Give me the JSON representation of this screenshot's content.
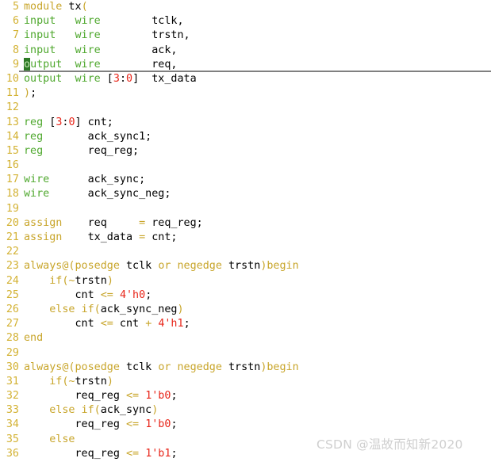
{
  "editor": {
    "language": "verilog",
    "first_line_number": 5,
    "last_line_number": 36,
    "background_color": "#ffffff",
    "gutter_color": "#d3b234",
    "cursor": {
      "line": 9,
      "column": 1,
      "character": "o",
      "block_background": "#2d7a25",
      "block_foreground": "#c9e9b8"
    },
    "current_line_underline_color": "#808080",
    "colors": {
      "keyword_green": "#4fa82e",
      "keyword_olive": "#c8a52a",
      "number_red": "#e8261a",
      "identifier_black": "#000000"
    },
    "lines": [
      {
        "n": "5",
        "text": "module tx("
      },
      {
        "n": "6",
        "text": "input   wire        tclk,"
      },
      {
        "n": "7",
        "text": "input   wire        trstn,"
      },
      {
        "n": "8",
        "text": "input   wire        ack,"
      },
      {
        "n": "9",
        "text": "output  wire        req,"
      },
      {
        "n": "10",
        "text": "output  wire [3:0]  tx_data"
      },
      {
        "n": "11",
        "text": ");"
      },
      {
        "n": "12",
        "text": ""
      },
      {
        "n": "13",
        "text": "reg [3:0] cnt;"
      },
      {
        "n": "14",
        "text": "reg       ack_sync1;"
      },
      {
        "n": "15",
        "text": "reg       req_reg;"
      },
      {
        "n": "16",
        "text": ""
      },
      {
        "n": "17",
        "text": "wire      ack_sync;"
      },
      {
        "n": "18",
        "text": "wire      ack_sync_neg;"
      },
      {
        "n": "19",
        "text": ""
      },
      {
        "n": "20",
        "text": "assign    req     = req_reg;"
      },
      {
        "n": "21",
        "text": "assign    tx_data = cnt;"
      },
      {
        "n": "22",
        "text": ""
      },
      {
        "n": "23",
        "text": "always@(posedge tclk or negedge trstn)begin"
      },
      {
        "n": "24",
        "text": "    if(~trstn)"
      },
      {
        "n": "25",
        "text": "        cnt <= 4'h0;"
      },
      {
        "n": "26",
        "text": "    else if(ack_sync_neg)"
      },
      {
        "n": "27",
        "text": "        cnt <= cnt + 4'h1;"
      },
      {
        "n": "28",
        "text": "end"
      },
      {
        "n": "29",
        "text": ""
      },
      {
        "n": "30",
        "text": "always@(posedge tclk or negedge trstn)begin"
      },
      {
        "n": "31",
        "text": "    if(~trstn)"
      },
      {
        "n": "32",
        "text": "        req_reg <= 1'b0;"
      },
      {
        "n": "33",
        "text": "    else if(ack_sync)"
      },
      {
        "n": "34",
        "text": "        req_reg <= 1'b0;"
      },
      {
        "n": "35",
        "text": "    else"
      },
      {
        "n": "36",
        "text": "        req_reg <= 1'b1;"
      }
    ]
  },
  "watermark": {
    "text": "CSDN @温故而知新2020",
    "color": "#cfcfcf"
  }
}
